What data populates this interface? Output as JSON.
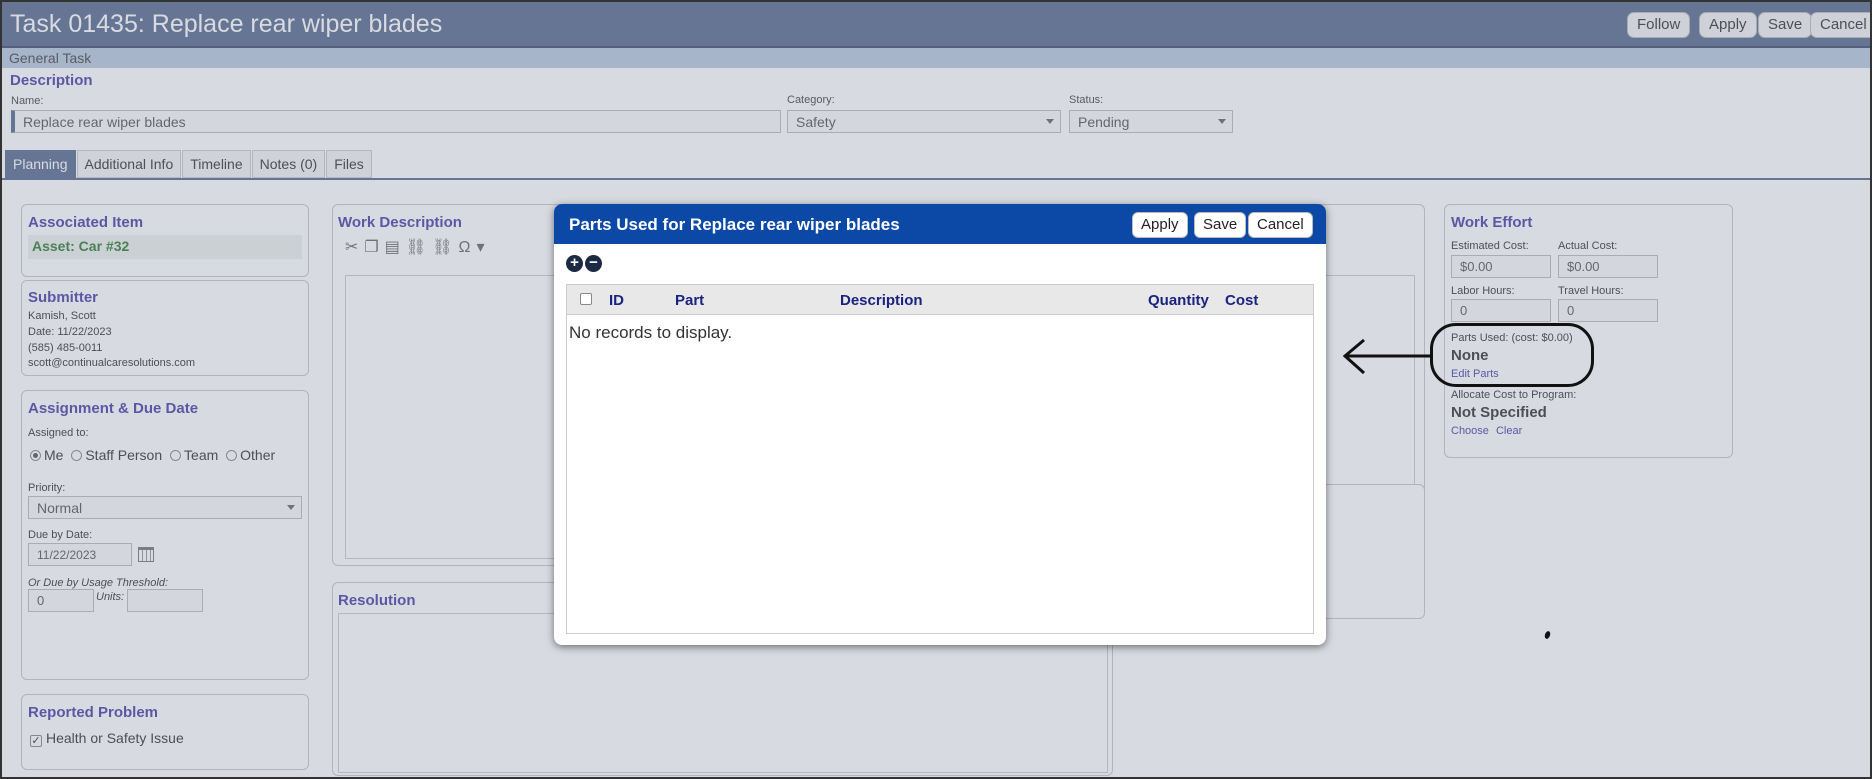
{
  "header": {
    "title": "Task 01435: Replace rear wiper blades",
    "buttons": [
      "Follow",
      "Apply",
      "Save",
      "Cancel"
    ],
    "subtitle": "General Task"
  },
  "description": {
    "heading": "Description",
    "name_label": "Name:",
    "name_value": "Replace rear wiper blades",
    "category_label": "Category:",
    "category_value": "Safety",
    "status_label": "Status:",
    "status_value": "Pending"
  },
  "tabs": [
    "Planning",
    "Additional Info",
    "Timeline",
    "Notes (0)",
    "Files"
  ],
  "associated_item": {
    "heading": "Associated Item",
    "value": "Asset: Car #32"
  },
  "submitter": {
    "heading": "Submitter",
    "name": "Kamish, Scott",
    "date": "Date: 11/22/2023",
    "phone": "(585) 485-0011",
    "email": "scott@continualcaresolutions.com"
  },
  "assignment": {
    "heading": "Assignment & Due Date",
    "assigned_label": "Assigned to:",
    "options": [
      "Me",
      "Staff Person",
      "Team",
      "Other"
    ],
    "priority_label": "Priority:",
    "priority_value": "Normal",
    "due_label": "Due by Date:",
    "due_value": "11/22/2023",
    "usage_label": "Or Due by Usage Threshold:",
    "usage_value": "0",
    "units_label": "Units:"
  },
  "reported_problem": {
    "heading": "Reported Problem",
    "checkbox_label": "Health or Safety Issue"
  },
  "work_description": {
    "heading": "Work Description"
  },
  "resolution": {
    "heading": "Resolution"
  },
  "work_effort": {
    "heading": "Work Effort",
    "estimated_label": "Estimated Cost:",
    "estimated_value": "$0.00",
    "actual_label": "Actual Cost:",
    "actual_value": "$0.00",
    "labor_label": "Labor Hours:",
    "labor_value": "0",
    "travel_label": "Travel Hours:",
    "travel_value": "0",
    "parts_label": "Parts Used: (cost: $0.00)",
    "parts_value": "None",
    "edit_parts": "Edit Parts",
    "allocate_label": "Allocate Cost to Program:",
    "allocate_value": "Not Specified",
    "choose": "Choose",
    "clear": "Clear"
  },
  "modal": {
    "title": "Parts Used for Replace rear wiper blades",
    "buttons": [
      "Apply",
      "Save",
      "Cancel"
    ],
    "columns": [
      "ID",
      "Part",
      "Description",
      "Quantity",
      "Cost"
    ],
    "empty_text": "No records to display."
  },
  "colors": {
    "header": "#5a6a90",
    "modal_header": "#0c49a6",
    "heading": "#4b3fa8"
  }
}
